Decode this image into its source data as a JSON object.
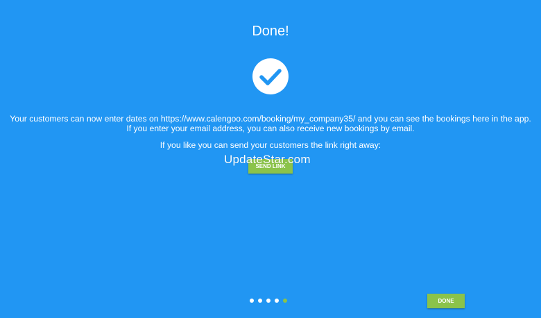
{
  "page": {
    "title": "Done!",
    "message_line1": "Your customers can now enter dates on https://www.calengoo.com/booking/my_company35/ and you can see the bookings here in the app.",
    "message_line2": "If you enter your email address, you can also receive new bookings by email.",
    "message_line3": "If you like you can send your customers the link right away:",
    "send_link_label": "SEND LINK",
    "done_label": "DONE",
    "watermark": "UpdateStar.com"
  },
  "pager": {
    "total": 5,
    "active_index": 4
  },
  "colors": {
    "background": "#2196f3",
    "button": "#8bc34a",
    "check": "#2196f3"
  },
  "icons": {
    "success": "checkmark-circle-icon"
  }
}
